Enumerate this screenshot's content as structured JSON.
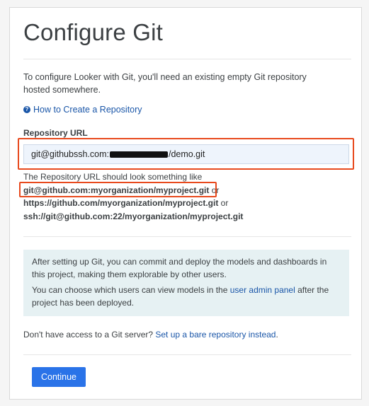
{
  "page": {
    "title": "Configure Git",
    "intro": "To configure Looker with Git, you'll need an existing empty Git repository hosted somewhere.",
    "help_link": "How to Create a Repository"
  },
  "repo_field": {
    "label": "Repository URL",
    "value_prefix": "git@githubssh.com:",
    "value_suffix": "/demo.git"
  },
  "hint": {
    "intro": "The Repository URL should look something like",
    "example1": "git@github.com:myorganization/myproject.git",
    "or1": " or",
    "example2": "https://github.com/myorganization/myproject.git",
    "or2": " or",
    "example3": "ssh://git@github.com:22/myorganization/myproject.git"
  },
  "info": {
    "p1": "After setting up Git, you can commit and deploy the models and dashboards in this project, making them explorable by other users.",
    "p2_before": "You can choose which users can view models in the ",
    "p2_link": "user admin panel",
    "p2_after": " after the project has been deployed."
  },
  "no_server": {
    "text": "Don't have access to a Git server? ",
    "link": "Set up a bare repository instead",
    "end": "."
  },
  "continue_label": "Continue",
  "colors": {
    "accent": "#2a73e8",
    "link": "#1a56a8",
    "highlight": "#e8491d",
    "info_bg": "#e6f1f3"
  }
}
